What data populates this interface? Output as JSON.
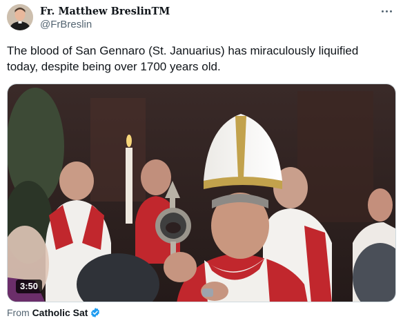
{
  "author": {
    "name": "Fr. Matthew Breslin",
    "badge": "TM",
    "handle": "@FrBreslin",
    "avatar_icon": "profile-photo"
  },
  "tweet": {
    "text": "The blood of San Gennaro (St. Januarius) has miraculously liquified today, despite being over 1700 years old."
  },
  "media": {
    "duration": "3:50"
  },
  "attribution": {
    "prefix": "From",
    "source": "Catholic Sat",
    "verified_icon": "verified-badge-icon",
    "verified_color": "#1d9bf0"
  },
  "menu_icon": "more-options-icon"
}
